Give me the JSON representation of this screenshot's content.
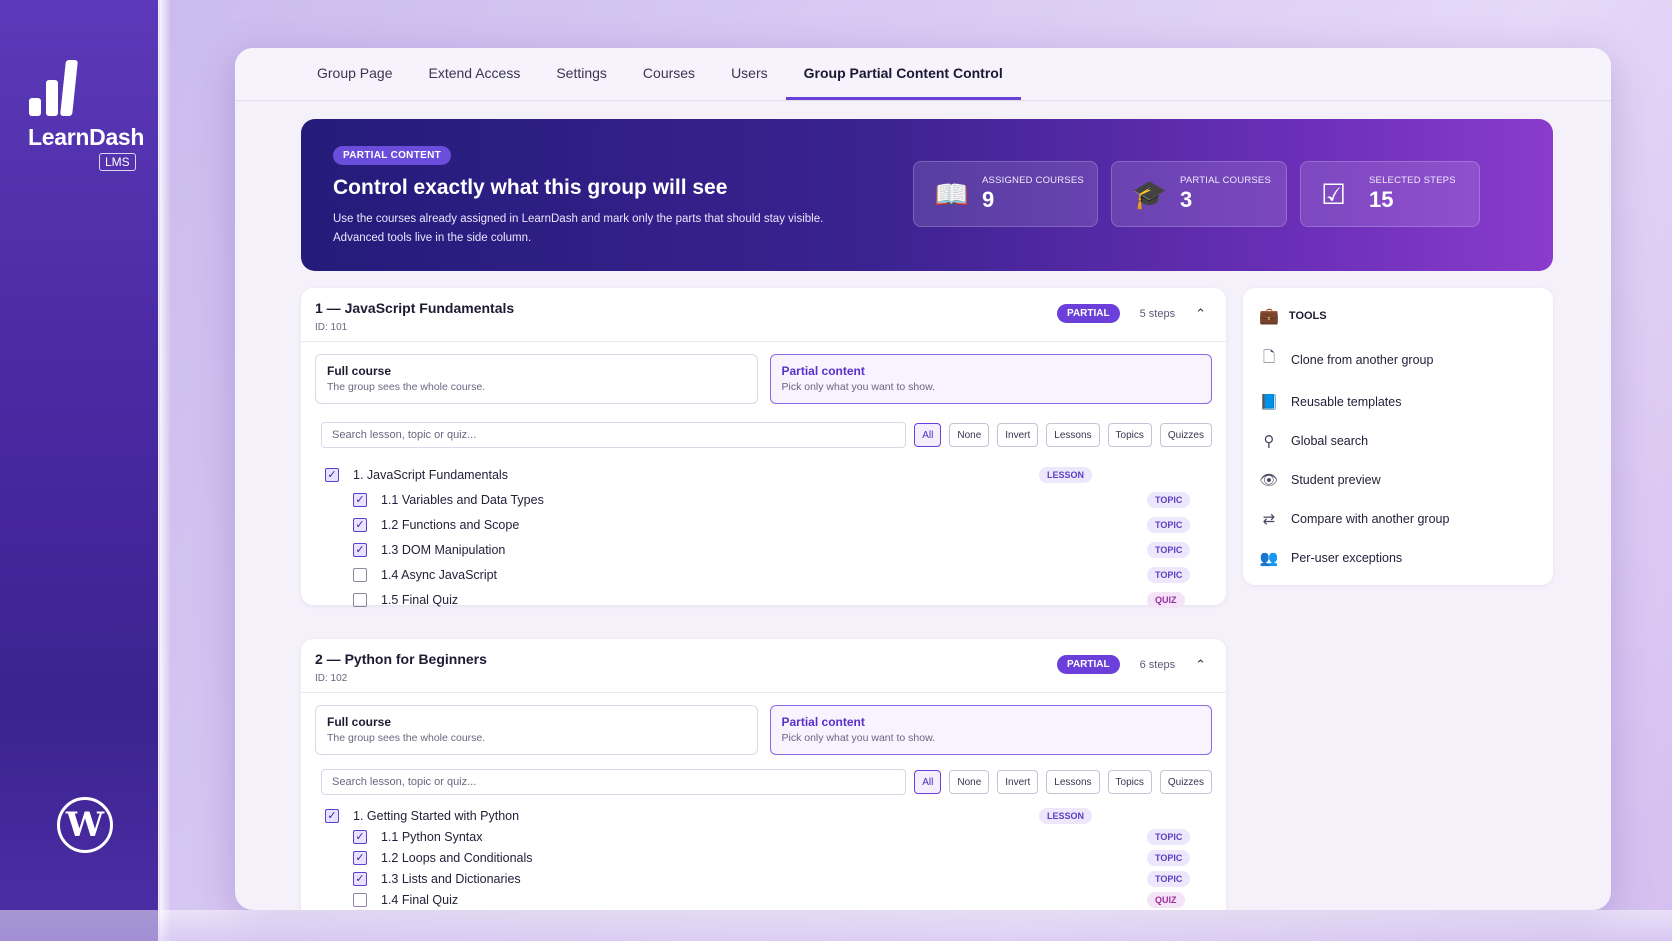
{
  "brand": {
    "name": "LearnDash",
    "badge": "LMS",
    "wordpress_glyph": "W"
  },
  "tabs": [
    {
      "label": "Group Page"
    },
    {
      "label": "Extend Access"
    },
    {
      "label": "Settings"
    },
    {
      "label": "Courses"
    },
    {
      "label": "Users"
    },
    {
      "label": "Group Partial Content Control",
      "active": true
    }
  ],
  "hero": {
    "badge": "PARTIAL CONTENT",
    "title": "Control exactly what this group will see",
    "desc_line1": "Use the courses already assigned in LearnDash and mark only the parts that should stay visible.",
    "desc_line2": "Advanced tools live in the side column.",
    "stats": [
      {
        "icon": "book-icon",
        "label": "ASSIGNED COURSES",
        "value": "9"
      },
      {
        "icon": "graduation-cap-icon",
        "label": "PARTIAL COURSES",
        "value": "3"
      },
      {
        "icon": "check-square-icon",
        "label": "SELECTED STEPS",
        "value": "15"
      }
    ]
  },
  "mode_labels": {
    "full_title": "Full course",
    "full_desc": "The group sees the whole course.",
    "partial_title": "Partial content",
    "partial_desc": "Pick only what you want to show."
  },
  "filters": {
    "search_placeholder": "Search lesson, topic or quiz...",
    "buttons": [
      "All",
      "None",
      "Invert",
      "Lessons",
      "Topics",
      "Quizzes"
    ]
  },
  "courses": [
    {
      "title": "1 — JavaScript Fundamentals",
      "id": "ID: 101",
      "status": "PARTIAL",
      "steps": "5 steps",
      "items": [
        {
          "label": "1. JavaScript Fundamentals",
          "type": "LESSON",
          "checked": true
        },
        {
          "label": "1.1 Variables and Data Types",
          "type": "TOPIC",
          "checked": true
        },
        {
          "label": "1.2 Functions and Scope",
          "type": "TOPIC",
          "checked": true
        },
        {
          "label": "1.3 DOM Manipulation",
          "type": "TOPIC",
          "checked": true
        },
        {
          "label": "1.4 Async JavaScript",
          "type": "TOPIC",
          "checked": false
        },
        {
          "label": "1.5 Final Quiz",
          "type": "QUIZ",
          "checked": false
        }
      ]
    },
    {
      "title": "2 — Python for Beginners",
      "id": "ID: 102",
      "status": "PARTIAL",
      "steps": "6 steps",
      "items": [
        {
          "label": "1. Getting Started with Python",
          "type": "LESSON",
          "checked": true
        },
        {
          "label": "1.1 Python Syntax",
          "type": "TOPIC",
          "checked": true
        },
        {
          "label": "1.2 Loops and Conditionals",
          "type": "TOPIC",
          "checked": true
        },
        {
          "label": "1.3 Lists and Dictionaries",
          "type": "TOPIC",
          "checked": true
        },
        {
          "label": "1.4 Final Quiz",
          "type": "QUIZ",
          "checked": false
        }
      ]
    }
  ],
  "tools": {
    "title": "TOOLS",
    "items": [
      {
        "icon": "clone-icon",
        "label": "Clone from another group"
      },
      {
        "icon": "template-icon",
        "label": "Reusable templates"
      },
      {
        "icon": "search-icon",
        "label": "Global search"
      },
      {
        "icon": "eye-icon",
        "label": "Student preview"
      },
      {
        "icon": "compare-icon",
        "label": "Compare with another group"
      },
      {
        "icon": "users-icon",
        "label": "Per-user exceptions"
      }
    ]
  },
  "colors": {
    "accent": "#6b3fd9",
    "hero_start": "#241b7a",
    "hero_end": "#8a3ccc"
  }
}
